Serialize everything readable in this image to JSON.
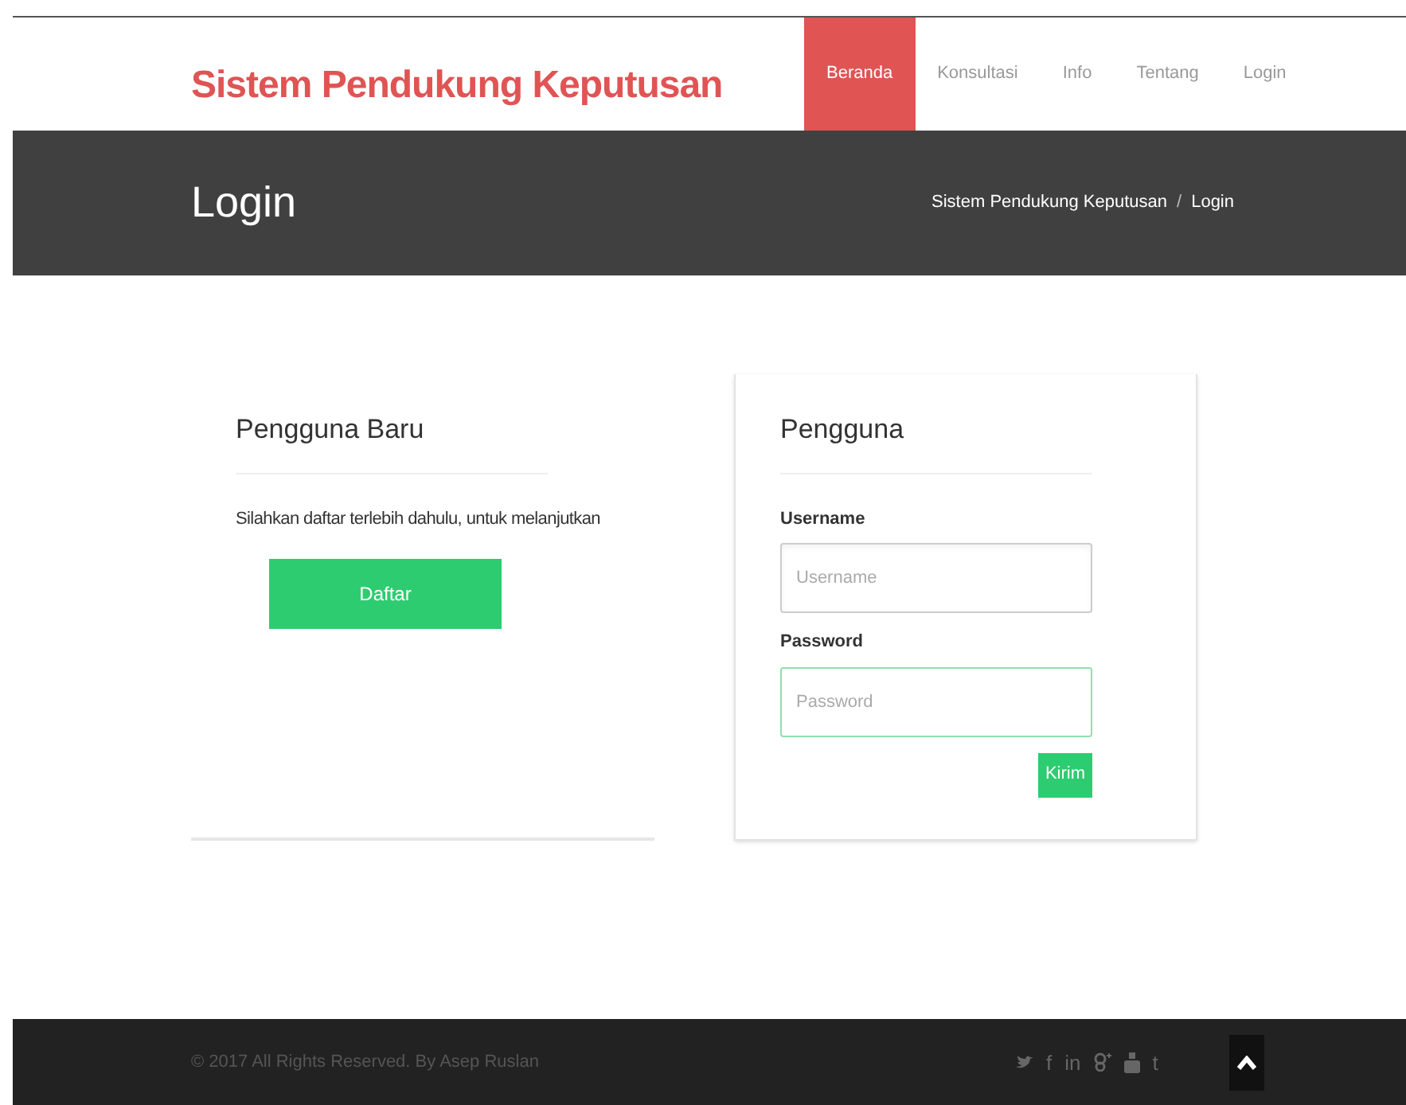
{
  "brand": "Sistem Pendukung Keputusan",
  "nav": [
    {
      "label": "Beranda",
      "selected": true
    },
    {
      "label": "Konsultasi",
      "selected": false
    },
    {
      "label": "Info",
      "selected": false
    },
    {
      "label": "Tentang",
      "selected": false
    },
    {
      "label": "Login",
      "selected": false
    }
  ],
  "page_title": "Login",
  "breadcrumb": [
    "Sistem Pendukung Keputusan",
    "Login"
  ],
  "breadcrumb_separator": "/",
  "new_user": {
    "title": "Pengguna Baru",
    "text": "Silahkan daftar terlebih dahulu, untuk melanjutkan",
    "button": "Daftar"
  },
  "login": {
    "title": "Pengguna",
    "fields": [
      {
        "label": "Username",
        "placeholder": "Username",
        "focused": false
      },
      {
        "label": "Password",
        "placeholder": "Password",
        "focused": true
      }
    ],
    "button": "Kirim"
  },
  "footer": {
    "copyright": "© 2017 All Rights Reserved. By Asep Ruslan",
    "social": [
      {
        "kind": "bird"
      },
      {
        "kind": "text",
        "label": "f"
      },
      {
        "kind": "text",
        "label": "in"
      },
      {
        "kind": "plus"
      },
      {
        "kind": "video"
      },
      {
        "kind": "text",
        "label": "t"
      }
    ]
  }
}
